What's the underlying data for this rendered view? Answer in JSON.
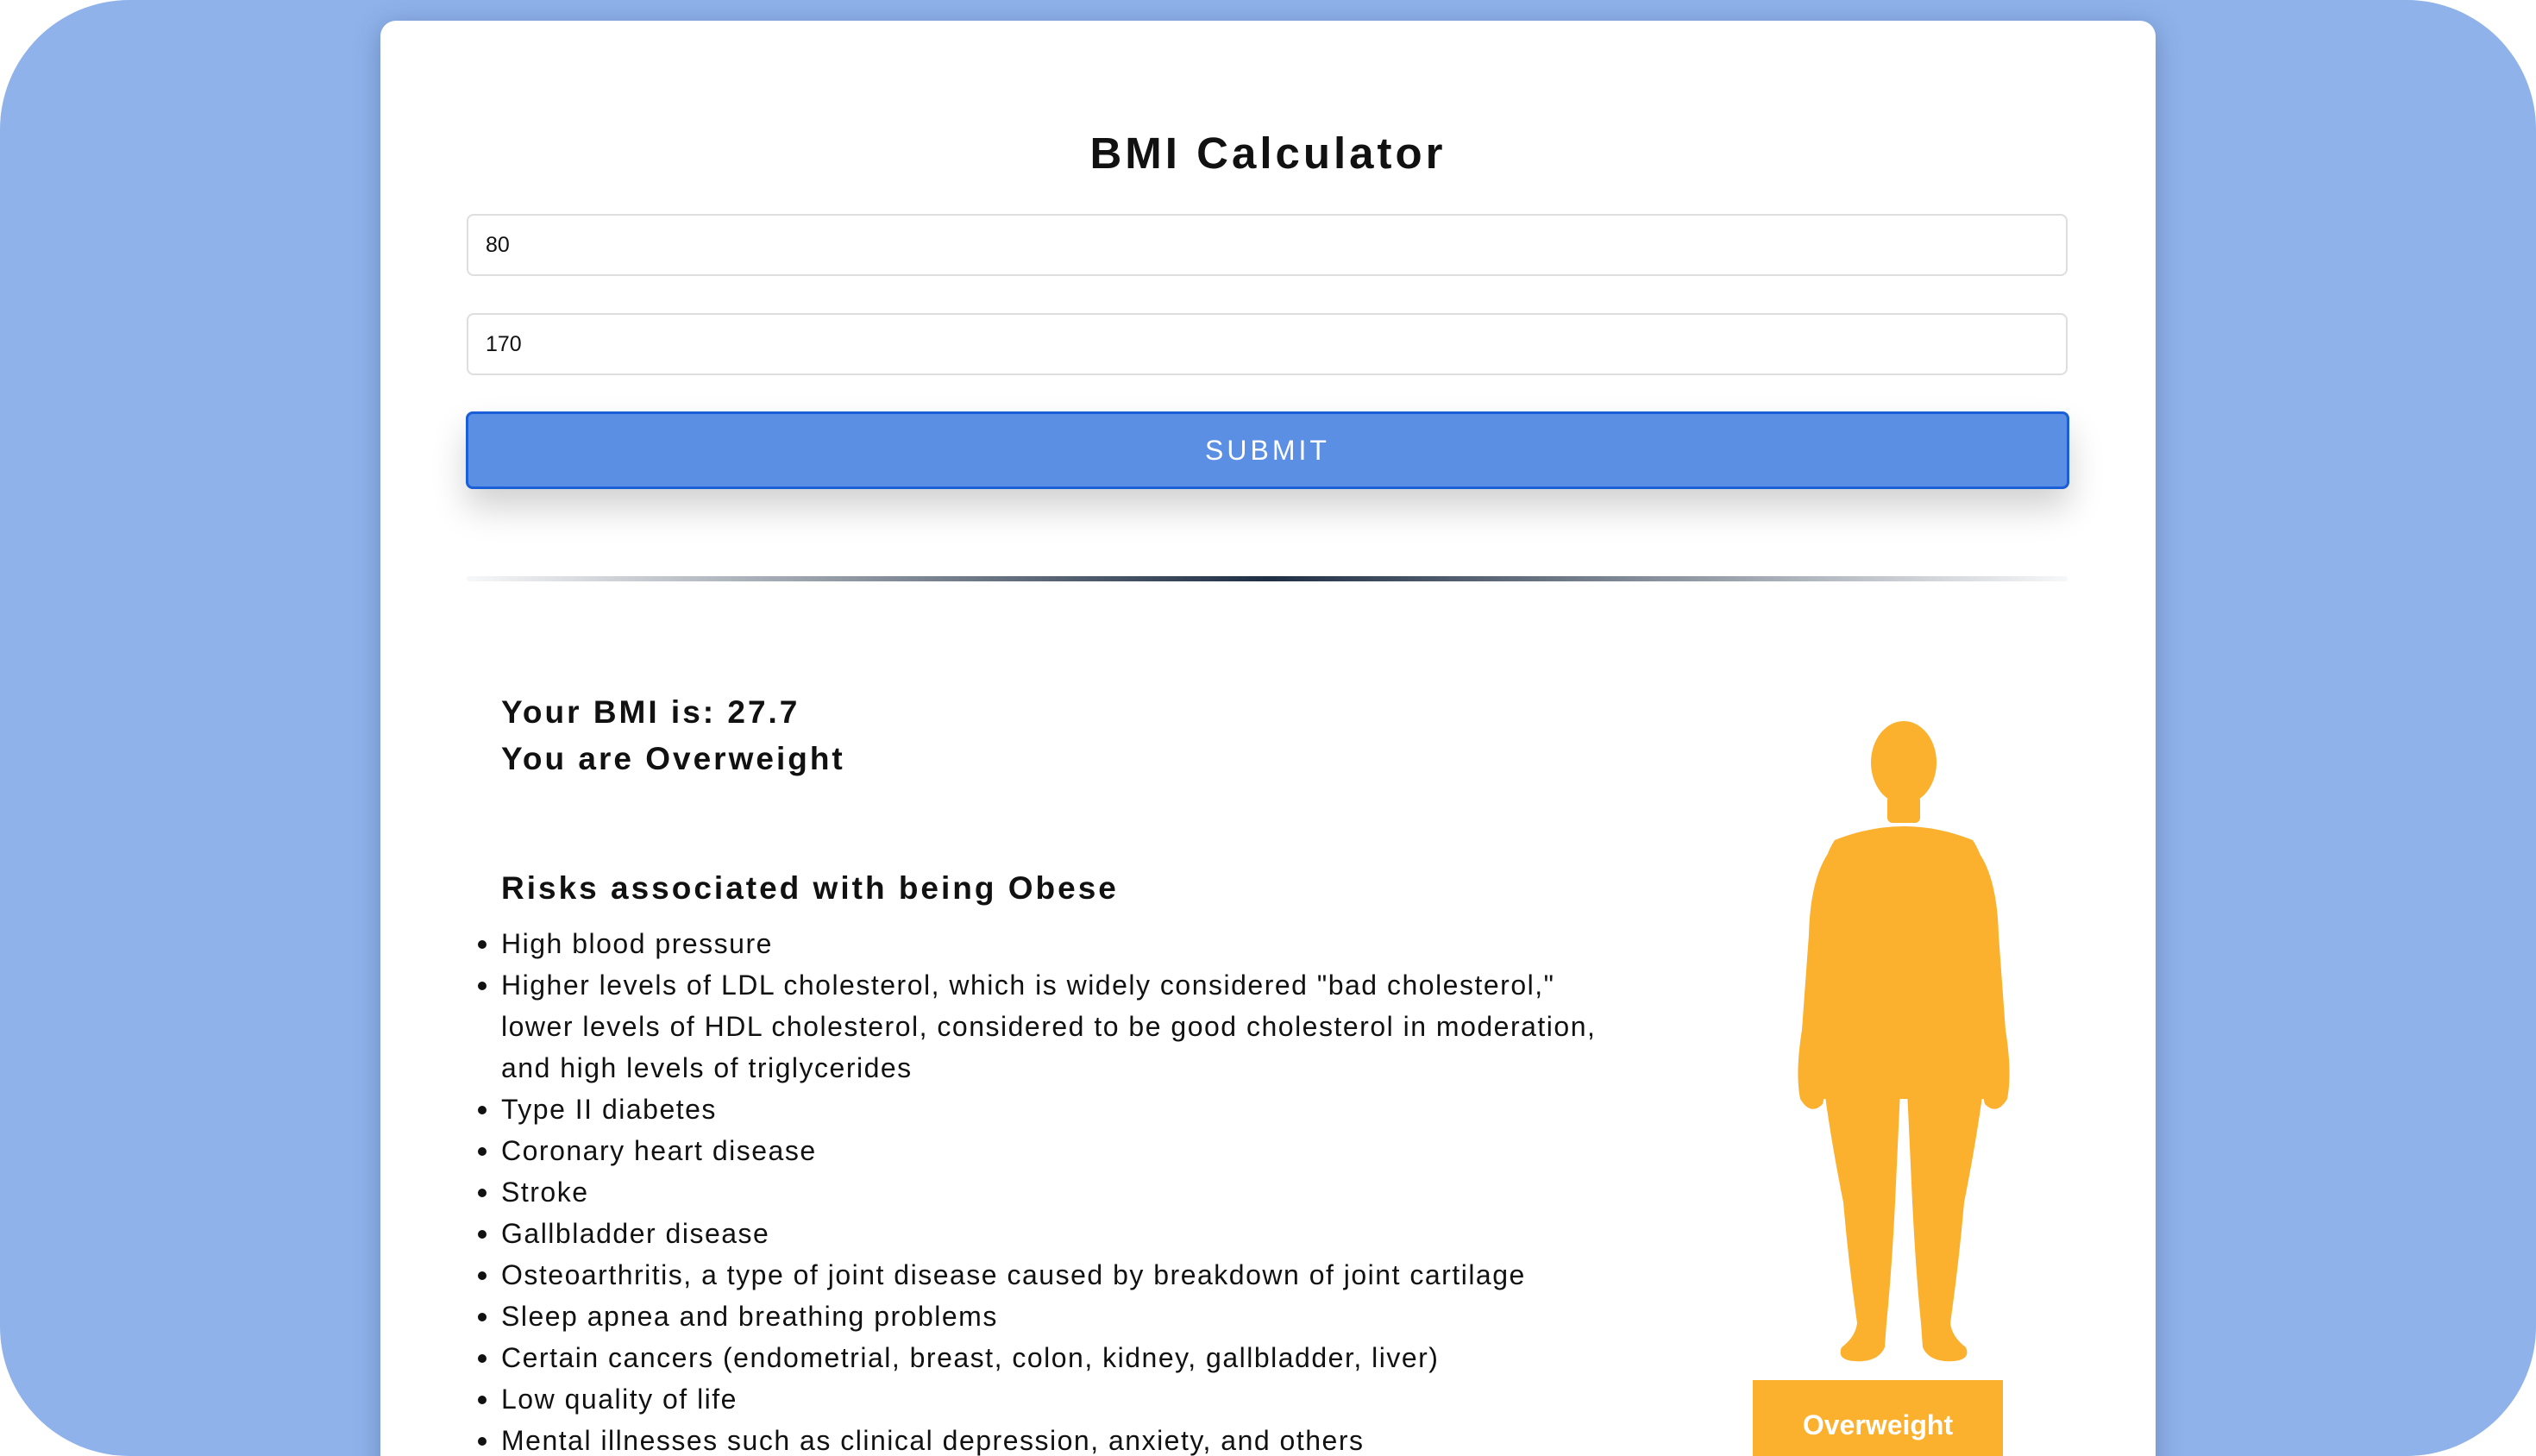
{
  "app": {
    "title": "BMI Calculator"
  },
  "form": {
    "weight_value": "80",
    "height_value": "170",
    "submit_label": "SUBMIT"
  },
  "result": {
    "bmi_line": "Your BMI is: 27.7",
    "category_line": "You are Overweight"
  },
  "risks": {
    "title": "Risks associated with being Obese",
    "items": [
      "High blood pressure",
      "Higher levels of LDL cholesterol, which is widely considered \"bad cholesterol,\" lower levels of HDL cholesterol, considered to be good cholesterol in moderation, and high levels of triglycerides",
      "Type II diabetes",
      "Coronary heart disease",
      "Stroke",
      "Gallbladder disease",
      "Osteoarthritis, a type of joint disease caused by breakdown of joint cartilage",
      "Sleep apnea and breathing problems",
      "Certain cancers (endometrial, breast, colon, kidney, gallbladder, liver)",
      "Low quality of life",
      "Mental illnesses such as clinical depression, anxiety, and others"
    ]
  },
  "illustration": {
    "icon": "body-silhouette-icon",
    "badge_label": "Overweight",
    "color": "#fbb02e"
  },
  "colors": {
    "background": "#8fb2ea",
    "button": "#5b8fe3",
    "button_border": "#1a5fd8",
    "status": "#fbb02e"
  }
}
